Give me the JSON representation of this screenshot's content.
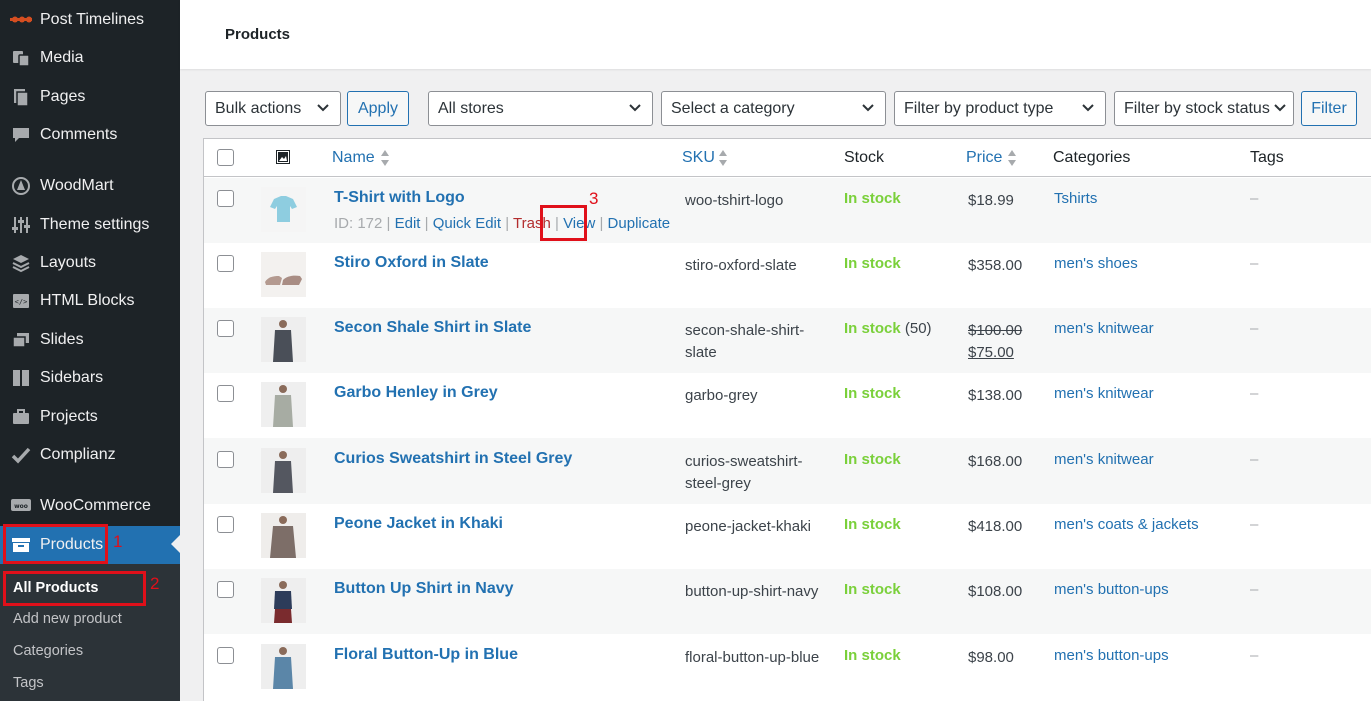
{
  "sidebar": {
    "items": [
      {
        "label": "Post Timelines",
        "icon": "timeline-icon"
      },
      {
        "label": "Media",
        "icon": "media-icon"
      },
      {
        "label": "Pages",
        "icon": "pages-icon"
      },
      {
        "label": "Comments",
        "icon": "comments-icon"
      },
      {
        "label": "WoodMart",
        "icon": "woodmart-icon"
      },
      {
        "label": "Theme settings",
        "icon": "sliders-icon"
      },
      {
        "label": "Layouts",
        "icon": "layers-icon"
      },
      {
        "label": "HTML Blocks",
        "icon": "html-blocks-icon"
      },
      {
        "label": "Slides",
        "icon": "slides-icon"
      },
      {
        "label": "Sidebars",
        "icon": "sidebars-icon"
      },
      {
        "label": "Projects",
        "icon": "briefcase-icon"
      },
      {
        "label": "Complianz",
        "icon": "check-icon"
      },
      {
        "label": "WooCommerce",
        "icon": "woocommerce-icon"
      },
      {
        "label": "Products",
        "icon": "archive-icon"
      }
    ],
    "submenu": [
      "All Products",
      "Add new product",
      "Categories",
      "Tags"
    ]
  },
  "header": {
    "title": "Products"
  },
  "filters": {
    "bulk_actions": "Bulk actions",
    "apply": "Apply",
    "stores": "All stores",
    "category": "Select a category",
    "product_type": "Filter by product type",
    "stock_status": "Filter by stock status",
    "filter": "Filter"
  },
  "table": {
    "columns": {
      "name": "Name",
      "sku": "SKU",
      "stock": "Stock",
      "price": "Price",
      "categories": "Categories",
      "tags": "Tags"
    },
    "row_actions": {
      "id": "ID: 172",
      "edit": "Edit",
      "quick_edit": "Quick Edit",
      "trash": "Trash",
      "view": "View",
      "duplicate": "Duplicate"
    },
    "rows": [
      {
        "name": "T-Shirt with Logo",
        "sku": "woo-tshirt-logo",
        "stock": "In stock",
        "stock_qty": "",
        "price": "$18.99",
        "regular_price": "",
        "category": "Tshirts",
        "tags": "–"
      },
      {
        "name": "Stiro Oxford in Slate",
        "sku": "stiro-oxford-slate",
        "stock": "In stock",
        "stock_qty": "",
        "price": "$358.00",
        "regular_price": "",
        "category": "men's shoes",
        "tags": "–"
      },
      {
        "name": "Secon Shale Shirt in Slate",
        "sku": "secon-shale-shirt-slate",
        "stock": "In stock",
        "stock_qty": "(50)",
        "price": "$75.00",
        "regular_price": "$100.00",
        "category": "men's knitwear",
        "tags": "–"
      },
      {
        "name": "Garbo Henley in Grey",
        "sku": "garbo-grey",
        "stock": "In stock",
        "stock_qty": "",
        "price": "$138.00",
        "regular_price": "",
        "category": "men's knitwear",
        "tags": "–"
      },
      {
        "name": "Curios Sweatshirt in Steel Grey",
        "sku": "curios-sweatshirt-steel-grey",
        "stock": "In stock",
        "stock_qty": "",
        "price": "$168.00",
        "regular_price": "",
        "category": "men's knitwear",
        "tags": "–"
      },
      {
        "name": "Peone Jacket in Khaki",
        "sku": "peone-jacket-khaki",
        "stock": "In stock",
        "stock_qty": "",
        "price": "$418.00",
        "regular_price": "",
        "category": "men's coats & jackets",
        "tags": "–"
      },
      {
        "name": "Button Up Shirt in Navy",
        "sku": "button-up-shirt-navy",
        "stock": "In stock",
        "stock_qty": "",
        "price": "$108.00",
        "regular_price": "",
        "category": "men's button-ups",
        "tags": "–"
      },
      {
        "name": "Floral Button-Up in Blue",
        "sku": "floral-button-up-blue",
        "stock": "In stock",
        "stock_qty": "",
        "price": "$98.00",
        "regular_price": "",
        "category": "men's button-ups",
        "tags": "–"
      }
    ]
  },
  "annotations": [
    "1",
    "2",
    "3"
  ],
  "colors": {
    "sidebar_bg": "#1d2327",
    "accent": "#2271b1",
    "in_stock": "#7ad03a",
    "trash": "#b32d2e",
    "annotation": "#e0101a"
  }
}
